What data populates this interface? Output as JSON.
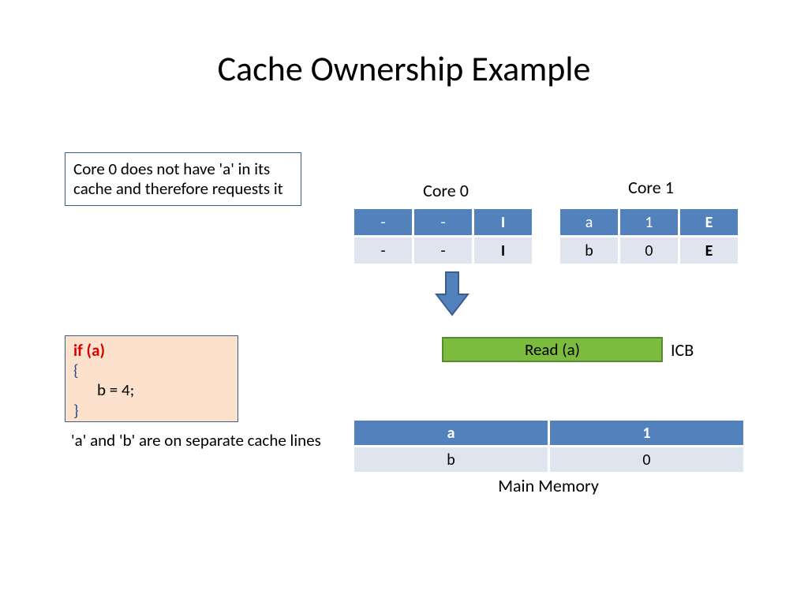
{
  "title": "Cache Ownership Example",
  "note": "Core 0 does not have 'a' in its cache and therefore requests it",
  "code": {
    "if_line": "if (a)",
    "open_brace": "{",
    "body": "b = 4;",
    "close_brace": "}"
  },
  "footnote": "'a' and 'b' are on separate cache lines",
  "cores": {
    "core0": {
      "label": "Core 0",
      "rows": [
        [
          "-",
          "-",
          "I"
        ],
        [
          "-",
          "-",
          "I"
        ]
      ]
    },
    "core1": {
      "label": "Core 1",
      "rows": [
        [
          "a",
          "1",
          "E"
        ],
        [
          "b",
          "0",
          "E"
        ]
      ]
    }
  },
  "icb": {
    "action": "Read (a)",
    "label": "ICB"
  },
  "memory": {
    "label": "Main Memory",
    "rows": [
      [
        "a",
        "1"
      ],
      [
        "b",
        "0"
      ]
    ]
  }
}
